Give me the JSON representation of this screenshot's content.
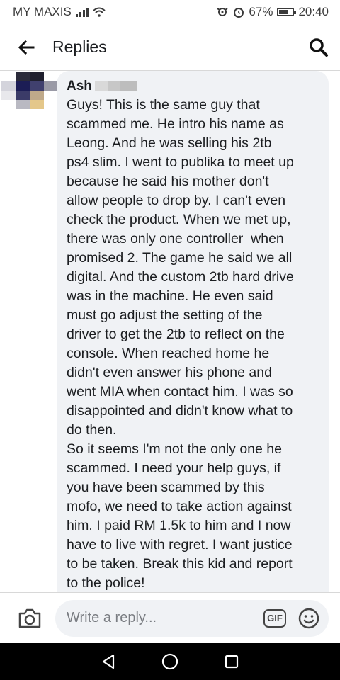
{
  "status_bar": {
    "carrier": "MY MAXIS",
    "battery_percent": "67%",
    "time": "20:40"
  },
  "header": {
    "title": "Replies",
    "icons": {
      "back": "back-arrow-icon",
      "search": "search-icon"
    }
  },
  "comment": {
    "author": "Ash",
    "text": "Guys! This is the same guy that\nscammed me. He intro his name as\nLeong. And he was selling his 2tb\nps4 slim. I went to publika to meet up\nbecause he said his mother don't\nallow people to drop by. I can't even\ncheck the product. When we met up,\nthere was only one controller  when\npromised 2. The game he said we all\ndigital. And the custom 2tb hard drive\nwas in the machine. He even said\nmust go adjust the setting of the\ndriver to get the 2tb to reflect on the\nconsole. When reached home he\ndidn't even answer his phone and\nwent MIA when contact him. I was so\ndisappointed and didn't know what to\ndo then.\nSo it seems I'm not the only one he\nscammed. I need your help guys, if\nyou have been scammed by this\nmofo, we need to take action against\nhim. I paid RM 1.5k to him and I now\nhave to live with regret. I want justice\nto be taken. Break this kid and report\nto the police!"
  },
  "composer": {
    "placeholder": "Write a reply...",
    "gif_label": "GIF",
    "icons": {
      "camera": "camera-icon",
      "emoji": "emoji-icon"
    }
  },
  "nav_bar": {
    "icons": [
      "back-triangle-icon",
      "home-circle-icon",
      "recents-square-icon"
    ]
  }
}
